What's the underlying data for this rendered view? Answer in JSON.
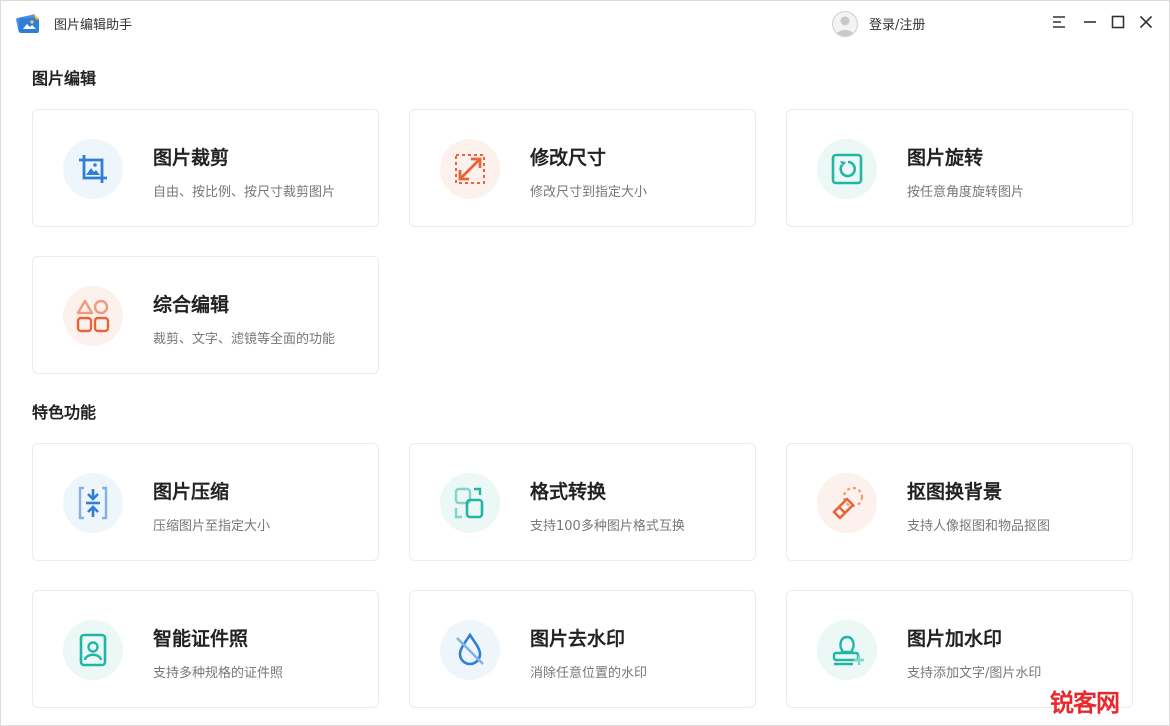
{
  "app": {
    "title": "图片编辑助手",
    "login_label": "登录/注册"
  },
  "icons": {
    "logo": "app-logo-icon",
    "avatar": "user-avatar-icon",
    "menu": "menu-icon",
    "minimize": "minimize-icon",
    "maximize": "maximize-icon",
    "close": "close-icon"
  },
  "colors": {
    "blue": "#2f7ed8",
    "orange": "#e8643a",
    "teal": "#22b5a6",
    "watermark": "#e8282d"
  },
  "sections": [
    {
      "title": "图片编辑",
      "cards": [
        {
          "title": "图片裁剪",
          "desc": "自由、按比例、按尺寸裁剪图片",
          "icon": "crop-icon"
        },
        {
          "title": "修改尺寸",
          "desc": "修改尺寸到指定大小",
          "icon": "resize-icon"
        },
        {
          "title": "图片旋转",
          "desc": "按任意角度旋转图片",
          "icon": "rotate-icon"
        },
        {
          "title": "综合编辑",
          "desc": "裁剪、文字、滤镜等全面的功能",
          "icon": "shapes-icon"
        }
      ]
    },
    {
      "title": "特色功能",
      "cards": [
        {
          "title": "图片压缩",
          "desc": "压缩图片至指定大小",
          "icon": "compress-icon"
        },
        {
          "title": "格式转换",
          "desc": "支持100多种图片格式互换",
          "icon": "convert-icon"
        },
        {
          "title": "抠图换背景",
          "desc": "支持人像抠图和物品抠图",
          "icon": "eraser-icon"
        },
        {
          "title": "智能证件照",
          "desc": "支持多种规格的证件照",
          "icon": "id-photo-icon"
        },
        {
          "title": "图片去水印",
          "desc": "消除任意位置的水印",
          "icon": "remove-watermark-icon"
        },
        {
          "title": "图片加水印",
          "desc": "支持添加文字/图片水印",
          "icon": "add-watermark-icon"
        }
      ]
    }
  ],
  "watermark": "锐客网"
}
